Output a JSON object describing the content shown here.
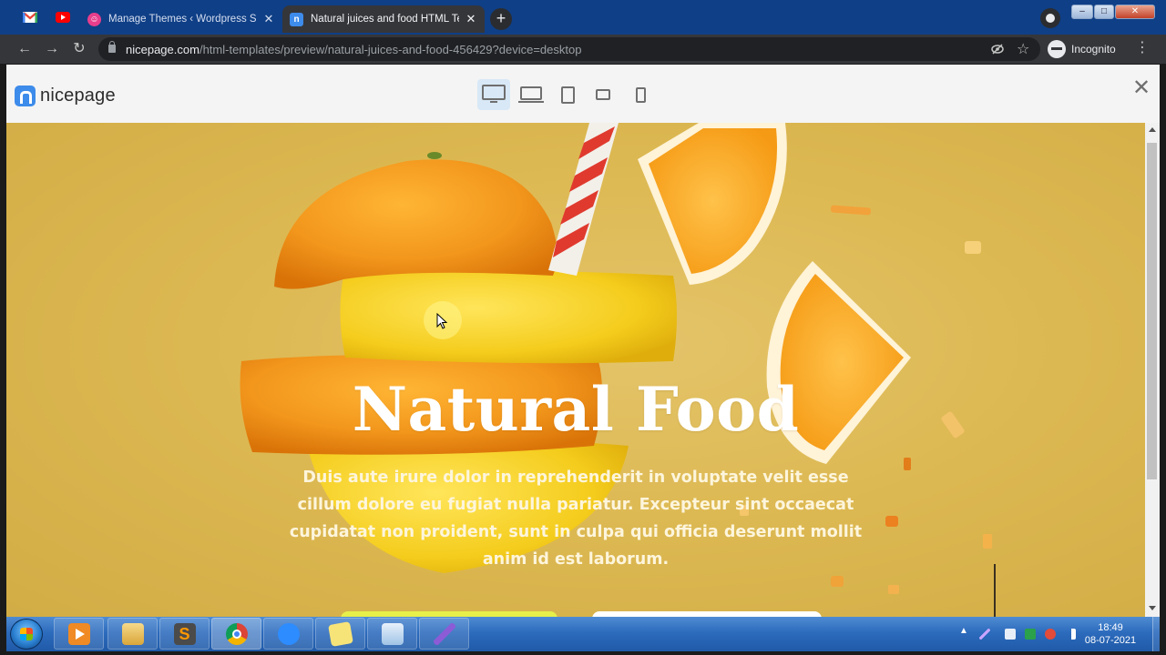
{
  "browser": {
    "tabs": [
      {
        "icon": "gmail-icon",
        "title": ""
      },
      {
        "icon": "youtube-icon",
        "title": ""
      },
      {
        "icon": "wordpress-themes-icon",
        "title": "Manage Themes ‹ Wordpress Sit"
      },
      {
        "icon": "nicepage-icon",
        "title": "Natural juices and food HTML Te",
        "active": true
      }
    ],
    "new_tab_label": "+",
    "window_buttons": {
      "minimize": "–",
      "restore": "□",
      "close": "✕"
    },
    "url_host": "nicepage.com",
    "url_path": "/html-templates/preview/natural-juices-and-food-456429?device=desktop",
    "profile_label": "Incognito"
  },
  "preview_header": {
    "logo_text": "nicepage",
    "devices": [
      "desktop-icon",
      "laptop-icon",
      "tablet-icon",
      "tablet-landscape-icon",
      "phone-icon"
    ],
    "active_device": "desktop-icon",
    "close_label": "✕"
  },
  "hero": {
    "title": "Natural Food",
    "text": "Duis aute irure dolor in reprehenderit in voluptate velit esse cillum dolore eu fugiat nulla pariatur. Excepteur sint occaecat cupidatat non proident, sunt in culpa qui officia deserunt mollit anim id est laborum.",
    "bg_color": "#ddb953"
  },
  "taskbar": {
    "apps": [
      "media-player-icon",
      "file-explorer-icon",
      "sublime-text-icon",
      "chrome-icon",
      "zoom-icon",
      "sticky-notes-icon",
      "notepad-icon",
      "pen-app-icon"
    ],
    "clock_time": "18:49",
    "clock_date": "08-07-2021"
  }
}
